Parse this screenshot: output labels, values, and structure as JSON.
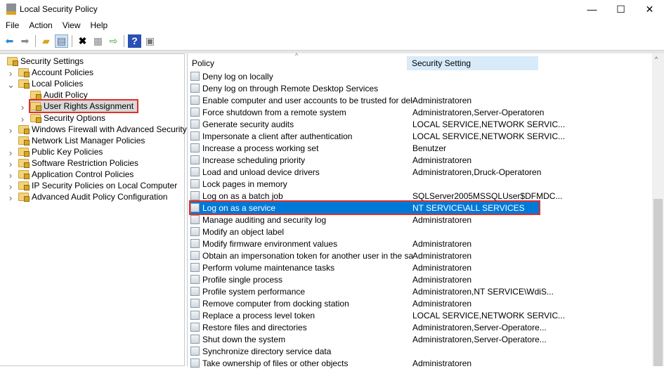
{
  "window": {
    "title": "Local Security Policy",
    "minimize": "—",
    "maximize": "☐",
    "close": "✕"
  },
  "menu": [
    "File",
    "Action",
    "View",
    "Help"
  ],
  "toolbar": [
    "back-arrow",
    "forward-arrow",
    "up-folder",
    "show-hide-console-tree",
    "delete",
    "properties",
    "export-list",
    "help",
    "show-action-pane"
  ],
  "tree": [
    {
      "label": "Security Settings",
      "level": 0,
      "expander": ""
    },
    {
      "label": "Account Policies",
      "level": 1,
      "expander": ">"
    },
    {
      "label": "Local Policies",
      "level": 1,
      "expander": "v"
    },
    {
      "label": "Audit Policy",
      "level": 2,
      "expander": ""
    },
    {
      "label": "User Rights Assignment",
      "level": 2,
      "expander": ">",
      "selected": true
    },
    {
      "label": "Security Options",
      "level": 2,
      "expander": ">"
    },
    {
      "label": "Windows Firewall with Advanced Security",
      "level": 1,
      "expander": ">"
    },
    {
      "label": "Network List Manager Policies",
      "level": 1,
      "expander": ""
    },
    {
      "label": "Public Key Policies",
      "level": 1,
      "expander": ">"
    },
    {
      "label": "Software Restriction Policies",
      "level": 1,
      "expander": ">"
    },
    {
      "label": "Application Control Policies",
      "level": 1,
      "expander": ">"
    },
    {
      "label": "IP Security Policies on Local Computer",
      "level": 1,
      "expander": ">"
    },
    {
      "label": "Advanced Audit Policy Configuration",
      "level": 1,
      "expander": ">"
    }
  ],
  "columns": {
    "policy": "Policy",
    "setting": "Security Setting"
  },
  "rows": [
    {
      "policy": "Deny log on locally",
      "setting": ""
    },
    {
      "policy": "Deny log on through Remote Desktop Services",
      "setting": ""
    },
    {
      "policy": "Enable computer and user accounts to be trusted for delega...",
      "setting": "Administratoren"
    },
    {
      "policy": "Force shutdown from a remote system",
      "setting": "Administratoren,Server-Operatoren"
    },
    {
      "policy": "Generate security audits",
      "setting": "LOCAL SERVICE,NETWORK SERVIC..."
    },
    {
      "policy": "Impersonate a client after authentication",
      "setting": "LOCAL SERVICE,NETWORK SERVIC..."
    },
    {
      "policy": "Increase a process working set",
      "setting": "Benutzer"
    },
    {
      "policy": "Increase scheduling priority",
      "setting": "Administratoren"
    },
    {
      "policy": "Load and unload device drivers",
      "setting": "Administratoren,Druck-Operatoren"
    },
    {
      "policy": "Lock pages in memory",
      "setting": ""
    },
    {
      "policy": "Log on as a batch job",
      "setting": "SQLServer2005MSSQLUser$DFMDC..."
    },
    {
      "policy": "Log on as a service",
      "setting": "NT SERVICE\\ALL SERVICES",
      "selected": true
    },
    {
      "policy": "Manage auditing and security log",
      "setting": "Administratoren"
    },
    {
      "policy": "Modify an object label",
      "setting": ""
    },
    {
      "policy": "Modify firmware environment values",
      "setting": "Administratoren"
    },
    {
      "policy": "Obtain an impersonation token for another user in the same...",
      "setting": "Administratoren"
    },
    {
      "policy": "Perform volume maintenance tasks",
      "setting": "Administratoren"
    },
    {
      "policy": "Profile single process",
      "setting": "Administratoren"
    },
    {
      "policy": "Profile system performance",
      "setting": "Administratoren,NT SERVICE\\WdiS..."
    },
    {
      "policy": "Remove computer from docking station",
      "setting": "Administratoren"
    },
    {
      "policy": "Replace a process level token",
      "setting": "LOCAL SERVICE,NETWORK SERVIC..."
    },
    {
      "policy": "Restore files and directories",
      "setting": "Administratoren,Server-Operatore..."
    },
    {
      "policy": "Shut down the system",
      "setting": "Administratoren,Server-Operatore..."
    },
    {
      "policy": "Synchronize directory service data",
      "setting": ""
    },
    {
      "policy": "Take ownership of files or other objects",
      "setting": "Administratoren"
    }
  ],
  "colors": {
    "selection": "#0078d7",
    "highlight_box": "#e0312a",
    "sorted_header": "#d9ebf9"
  }
}
